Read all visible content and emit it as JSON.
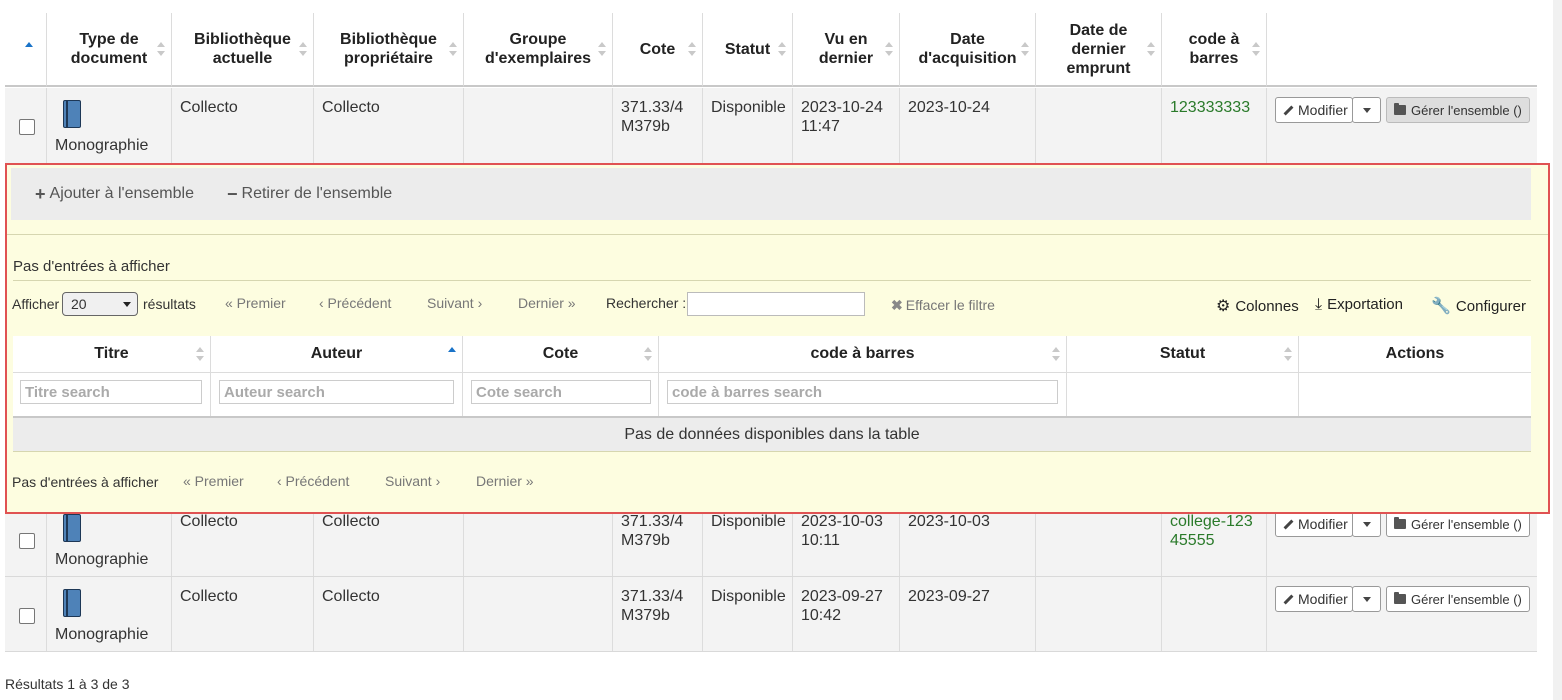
{
  "table": {
    "headers": [
      "",
      "Type de document",
      "Bibliothèque actuelle",
      "Bibliothèque propriétaire",
      "Groupe d'exemplaires",
      "Cote",
      "Statut",
      "Vu en dernier",
      "Date d'acquisition",
      "Date de dernier emprunt",
      "code à barres",
      ""
    ],
    "rows": [
      {
        "type": "Monographie",
        "lib_actuelle": "Collecto",
        "lib_proprio": "Collecto",
        "groupe": "",
        "cote": "371.33/4 M379b",
        "statut": "Disponible",
        "vu": "2023-10-24 11:47",
        "acq": "2023-10-24",
        "emprunt": "",
        "barcode": "123333333"
      },
      {
        "type": "Monographie",
        "lib_actuelle": "Collecto",
        "lib_proprio": "Collecto",
        "groupe": "",
        "cote": "371.33/4 M379b",
        "statut": "Disponible",
        "vu": "2023-10-03 10:11",
        "acq": "2023-10-03",
        "emprunt": "",
        "barcode": "college-12345555"
      },
      {
        "type": "Monographie",
        "lib_actuelle": "Collecto",
        "lib_proprio": "Collecto",
        "groupe": "",
        "cote": "371.33/4 M379b",
        "statut": "Disponible",
        "vu": "2023-09-27 10:42",
        "acq": "2023-09-27",
        "emprunt": "",
        "barcode": ""
      }
    ],
    "modify_label": "Modifier",
    "manage_label": "Gérer l'ensemble ()"
  },
  "panel": {
    "add_label": "Ajouter à l'ensemble",
    "remove_label": "Retirer de l'ensemble",
    "no_entries": "Pas d'entrées à afficher",
    "show_label": "Afficher",
    "page_size": "20",
    "results_label": "résultats",
    "first": "« Premier",
    "prev": "‹ Précédent",
    "next": "Suivant ›",
    "last": "Dernier »",
    "search_label": "Rechercher :",
    "search_value": "",
    "clear_filter": "Effacer le filtre",
    "columns_label": "Colonnes",
    "export_label": "Exportation",
    "configure_label": "Configurer",
    "columns": [
      "Titre",
      "Auteur",
      "Cote",
      "code à barres",
      "Statut",
      "Actions"
    ],
    "placeholders": [
      "Titre search",
      "Auteur search",
      "Cote search",
      "code à barres search"
    ],
    "empty": "Pas de données disponibles dans la table",
    "footer_entries": "Pas d'entrées à afficher"
  },
  "footer": {
    "results": "Résultats 1 à 3 de 3"
  }
}
